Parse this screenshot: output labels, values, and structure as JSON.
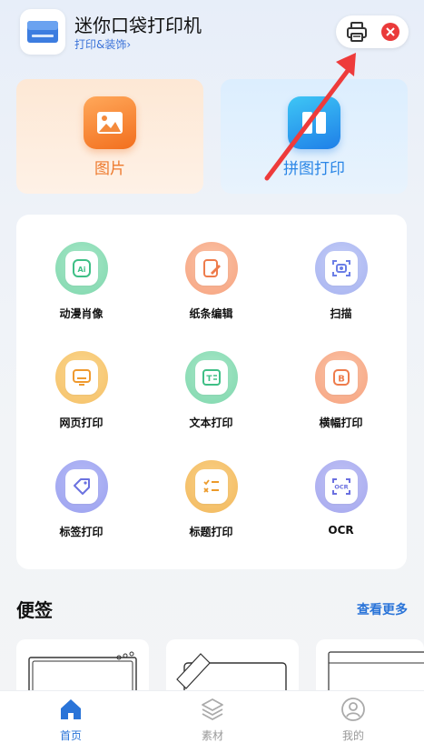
{
  "header": {
    "title": "迷你口袋打印机",
    "subtitle": "打印&装饰",
    "print_icon": "printer-icon",
    "close_icon": "close-icon"
  },
  "features": [
    {
      "label": "图片",
      "icon": "picture-icon"
    },
    {
      "label": "拼图打印",
      "icon": "collage-icon"
    }
  ],
  "tools": [
    {
      "label": "动漫肖像",
      "icon": "ai-portrait-icon"
    },
    {
      "label": "纸条编辑",
      "icon": "note-edit-icon"
    },
    {
      "label": "扫描",
      "icon": "scan-icon"
    },
    {
      "label": "网页打印",
      "icon": "web-print-icon"
    },
    {
      "label": "文本打印",
      "icon": "text-print-icon"
    },
    {
      "label": "横幅打印",
      "icon": "banner-print-icon"
    },
    {
      "label": "标签打印",
      "icon": "label-print-icon"
    },
    {
      "label": "标题打印",
      "icon": "title-print-icon"
    },
    {
      "label": "OCR",
      "icon": "ocr-icon"
    }
  ],
  "notes": {
    "title": "便签",
    "more": "查看更多"
  },
  "nav": [
    {
      "label": "首页",
      "icon": "home-icon",
      "active": true
    },
    {
      "label": "素材",
      "icon": "layers-icon",
      "active": false
    },
    {
      "label": "我的",
      "icon": "user-icon",
      "active": false
    }
  ],
  "colors": {
    "accent": "#2a74d8",
    "close": "#ea3a3a",
    "annotation_arrow": "#ee3b3b"
  }
}
